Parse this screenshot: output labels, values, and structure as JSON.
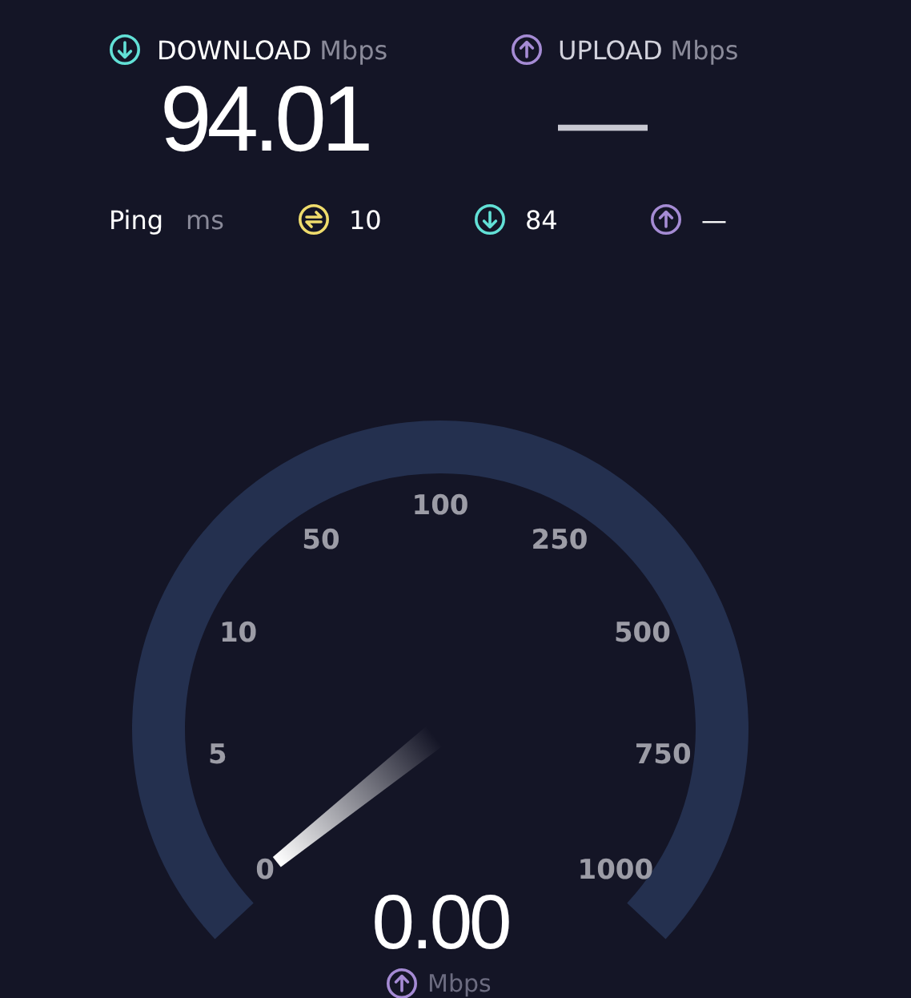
{
  "results": [
    {
      "kind": "download",
      "label": "DOWNLOAD",
      "unit": "Mbps",
      "value": "94.01"
    },
    {
      "kind": "upload",
      "label": "UPLOAD",
      "unit": "Mbps",
      "value": "—"
    }
  ],
  "ping": {
    "label": "Ping",
    "unit": "ms",
    "items": [
      {
        "kind": "jitter",
        "value": "10"
      },
      {
        "kind": "download",
        "value": "84"
      },
      {
        "kind": "upload",
        "value": "—"
      }
    ]
  },
  "gauge": {
    "ticks": [
      "0",
      "5",
      "10",
      "50",
      "100",
      "250",
      "500",
      "750",
      "1000"
    ],
    "reading": "0.00",
    "unit": "Mbps",
    "kind": "upload"
  }
}
